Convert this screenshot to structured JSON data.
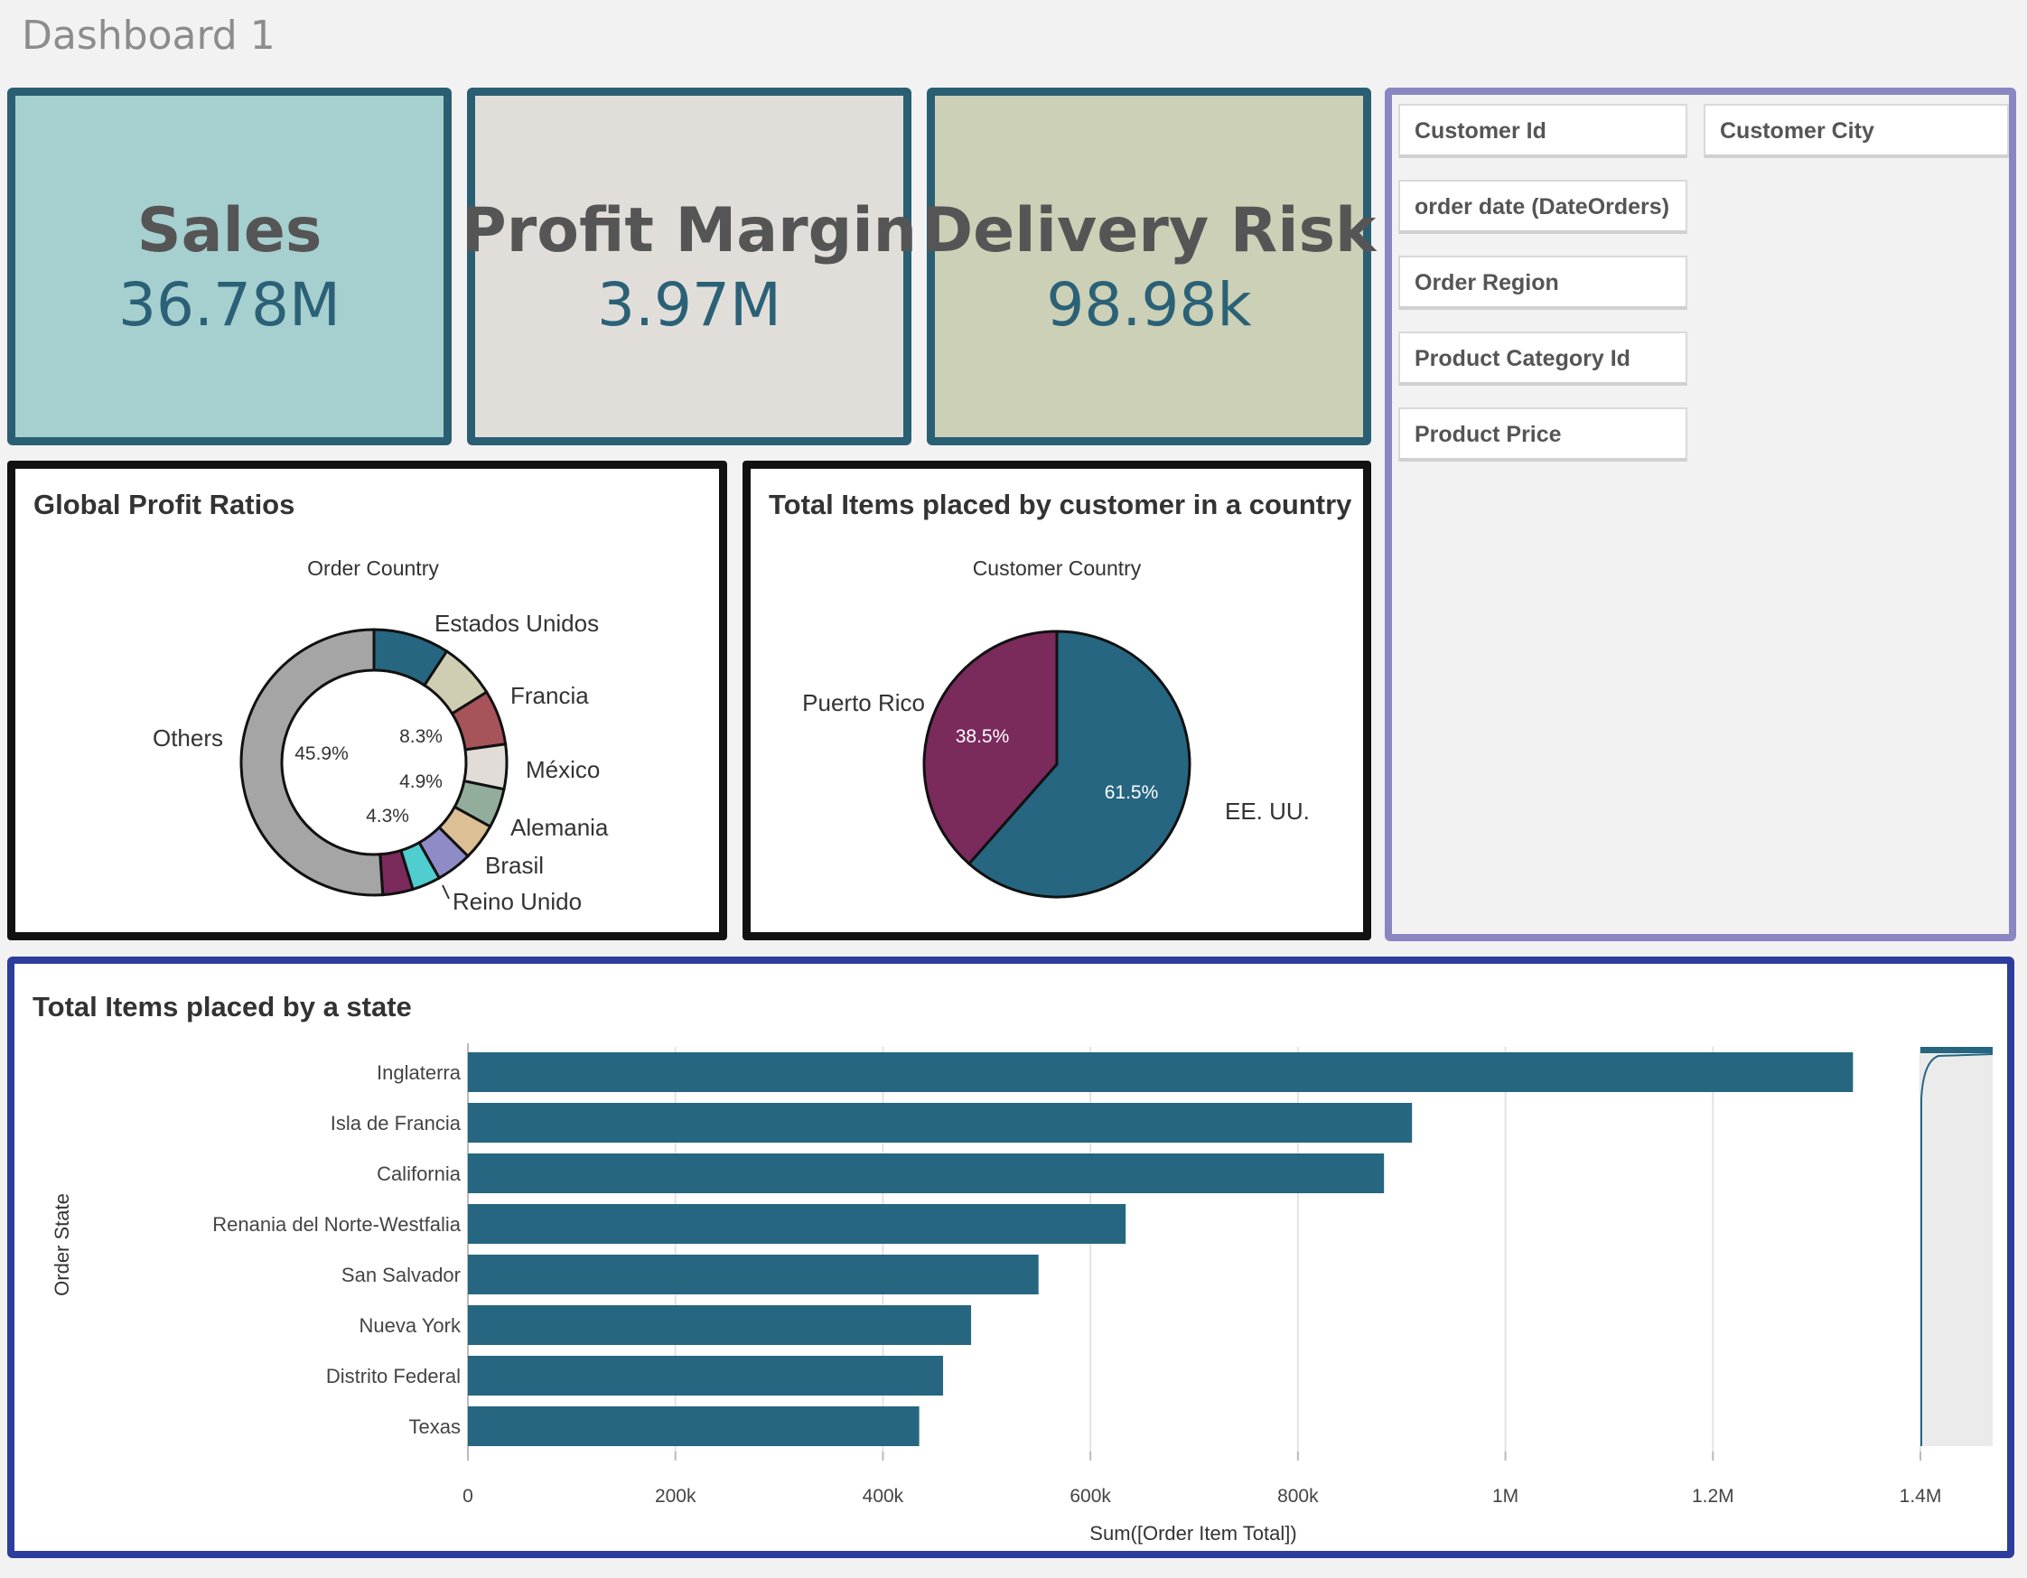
{
  "dashboard": {
    "title": "Dashboard 1"
  },
  "kpis": [
    {
      "label": "Sales",
      "value": "36.78M",
      "bg": "#a6cfcf"
    },
    {
      "label": "Profit Margin",
      "value": "3.97M",
      "bg": "#e1deda"
    },
    {
      "label": "Delivery Risk",
      "value": "98.98k",
      "bg": "#cbd0b6"
    }
  ],
  "filters": {
    "items": [
      "Customer Id",
      "Customer City",
      "order date (DateOrders)",
      "Order Region",
      "Product Category Id",
      "Product Price"
    ]
  },
  "colors": {
    "primary": "#266680",
    "kpi_border": "#2a5f73",
    "filter_border": "#8a86c2",
    "bar_border": "#2d3d9c"
  },
  "chart_data": [
    {
      "type": "pie",
      "variant": "donut",
      "title": "Global Profit Ratios",
      "dimension_label": "Order Country",
      "slices": [
        {
          "label": "Estados Unidos",
          "value": 8.3,
          "color": "#266680"
        },
        {
          "label": "Francia",
          "value": 6.2,
          "color": "#cfcdb2"
        },
        {
          "label": "México",
          "value": 6.0,
          "color": "#a65459"
        },
        {
          "label": "Alemania",
          "value": 4.9,
          "color": "#e1dcd8"
        },
        {
          "label": "Brasil",
          "value": 4.3,
          "color": "#93ad9d"
        },
        {
          "label": "Reino Unido",
          "value": 4.0,
          "color": "#dcbf94"
        },
        {
          "label": "",
          "value": 3.9,
          "color": "#8f8bc6"
        },
        {
          "label": "",
          "value": 3.1,
          "color": "#4fcdcf"
        },
        {
          "label": "",
          "value": 3.3,
          "color": "#7b2a5c"
        },
        {
          "label": "Others",
          "value": 45.9,
          "color": "#a5a5a5"
        }
      ],
      "inner_labels": [
        "45.9%",
        "8.3%",
        "4.9%",
        "4.3%"
      ]
    },
    {
      "type": "pie",
      "title": "Total Items placed by customer in a country",
      "dimension_label": "Customer Country",
      "slices": [
        {
          "label": "EE. UU.",
          "value": 61.5,
          "percent_label": "61.5%",
          "color": "#266680"
        },
        {
          "label": "Puerto Rico",
          "value": 38.5,
          "percent_label": "38.5%",
          "color": "#7b2a5c"
        }
      ]
    },
    {
      "type": "bar",
      "orientation": "horizontal",
      "title": "Total Items placed by a state",
      "ylabel": "Order State",
      "xlabel": "Sum([Order Item Total])",
      "categories": [
        "Inglaterra",
        "Isla de Francia",
        "California",
        "Renania del Norte-Westfalia",
        "San Salvador",
        "Nueva York",
        "Distrito Federal",
        "Texas"
      ],
      "values": [
        1335000,
        910000,
        883000,
        634000,
        550000,
        485000,
        458000,
        435000
      ],
      "xlim": [
        0,
        1400000
      ],
      "xticks": [
        0,
        200000,
        400000,
        600000,
        800000,
        1000000,
        1200000,
        1400000
      ],
      "xtick_labels": [
        "0",
        "200k",
        "400k",
        "600k",
        "800k",
        "1M",
        "1.2M",
        "1.4M"
      ],
      "grid": true,
      "color": "#266680"
    }
  ]
}
